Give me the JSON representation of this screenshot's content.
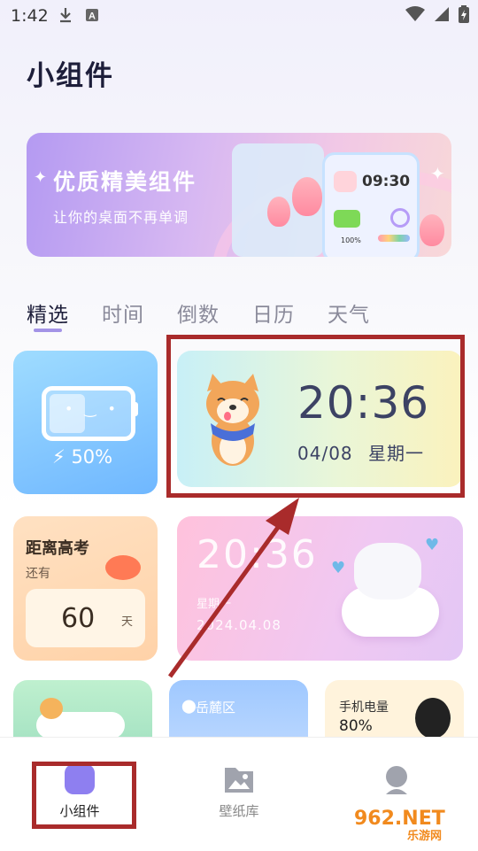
{
  "status_bar": {
    "time": "1:42",
    "icons": [
      "download-icon",
      "text-a-icon",
      "wifi-icon",
      "signal-icon",
      "battery-icon"
    ]
  },
  "page": {
    "title": "小组件"
  },
  "banner": {
    "title": "优质精美组件",
    "subtitle": "让你的桌面不再单调",
    "preview_time": "09:30",
    "preview_battery": "100%"
  },
  "tabs": [
    {
      "label": "精选",
      "active": true
    },
    {
      "label": "时间",
      "active": false
    },
    {
      "label": "倒数",
      "active": false
    },
    {
      "label": "日历",
      "active": false
    },
    {
      "label": "天气",
      "active": false
    }
  ],
  "widgets": {
    "battery": {
      "percent_text": "50%",
      "level": 0.5
    },
    "clock": {
      "time": "20:36",
      "date": "04/08",
      "weekday": "星期一"
    },
    "exam": {
      "title": "距离高考",
      "sub": "还有",
      "days": "60",
      "unit": "天"
    },
    "cat_clock": {
      "time": "20:36",
      "weekday": "星期一",
      "date": "2024.04.08"
    },
    "location": {
      "label": "岳麓区"
    },
    "phone_battery": {
      "title": "手机电量",
      "value": "80%"
    }
  },
  "bottom_nav": [
    {
      "label": "小组件",
      "active": true
    },
    {
      "label": "壁纸库",
      "active": false
    },
    {
      "label": "",
      "active": false
    }
  ],
  "watermark": {
    "brand": "962.NET",
    "cn": "乐游网"
  },
  "colors": {
    "accent": "#a393e6",
    "highlight_red": "#a92b2b",
    "text_dark": "#1d1e3a"
  }
}
